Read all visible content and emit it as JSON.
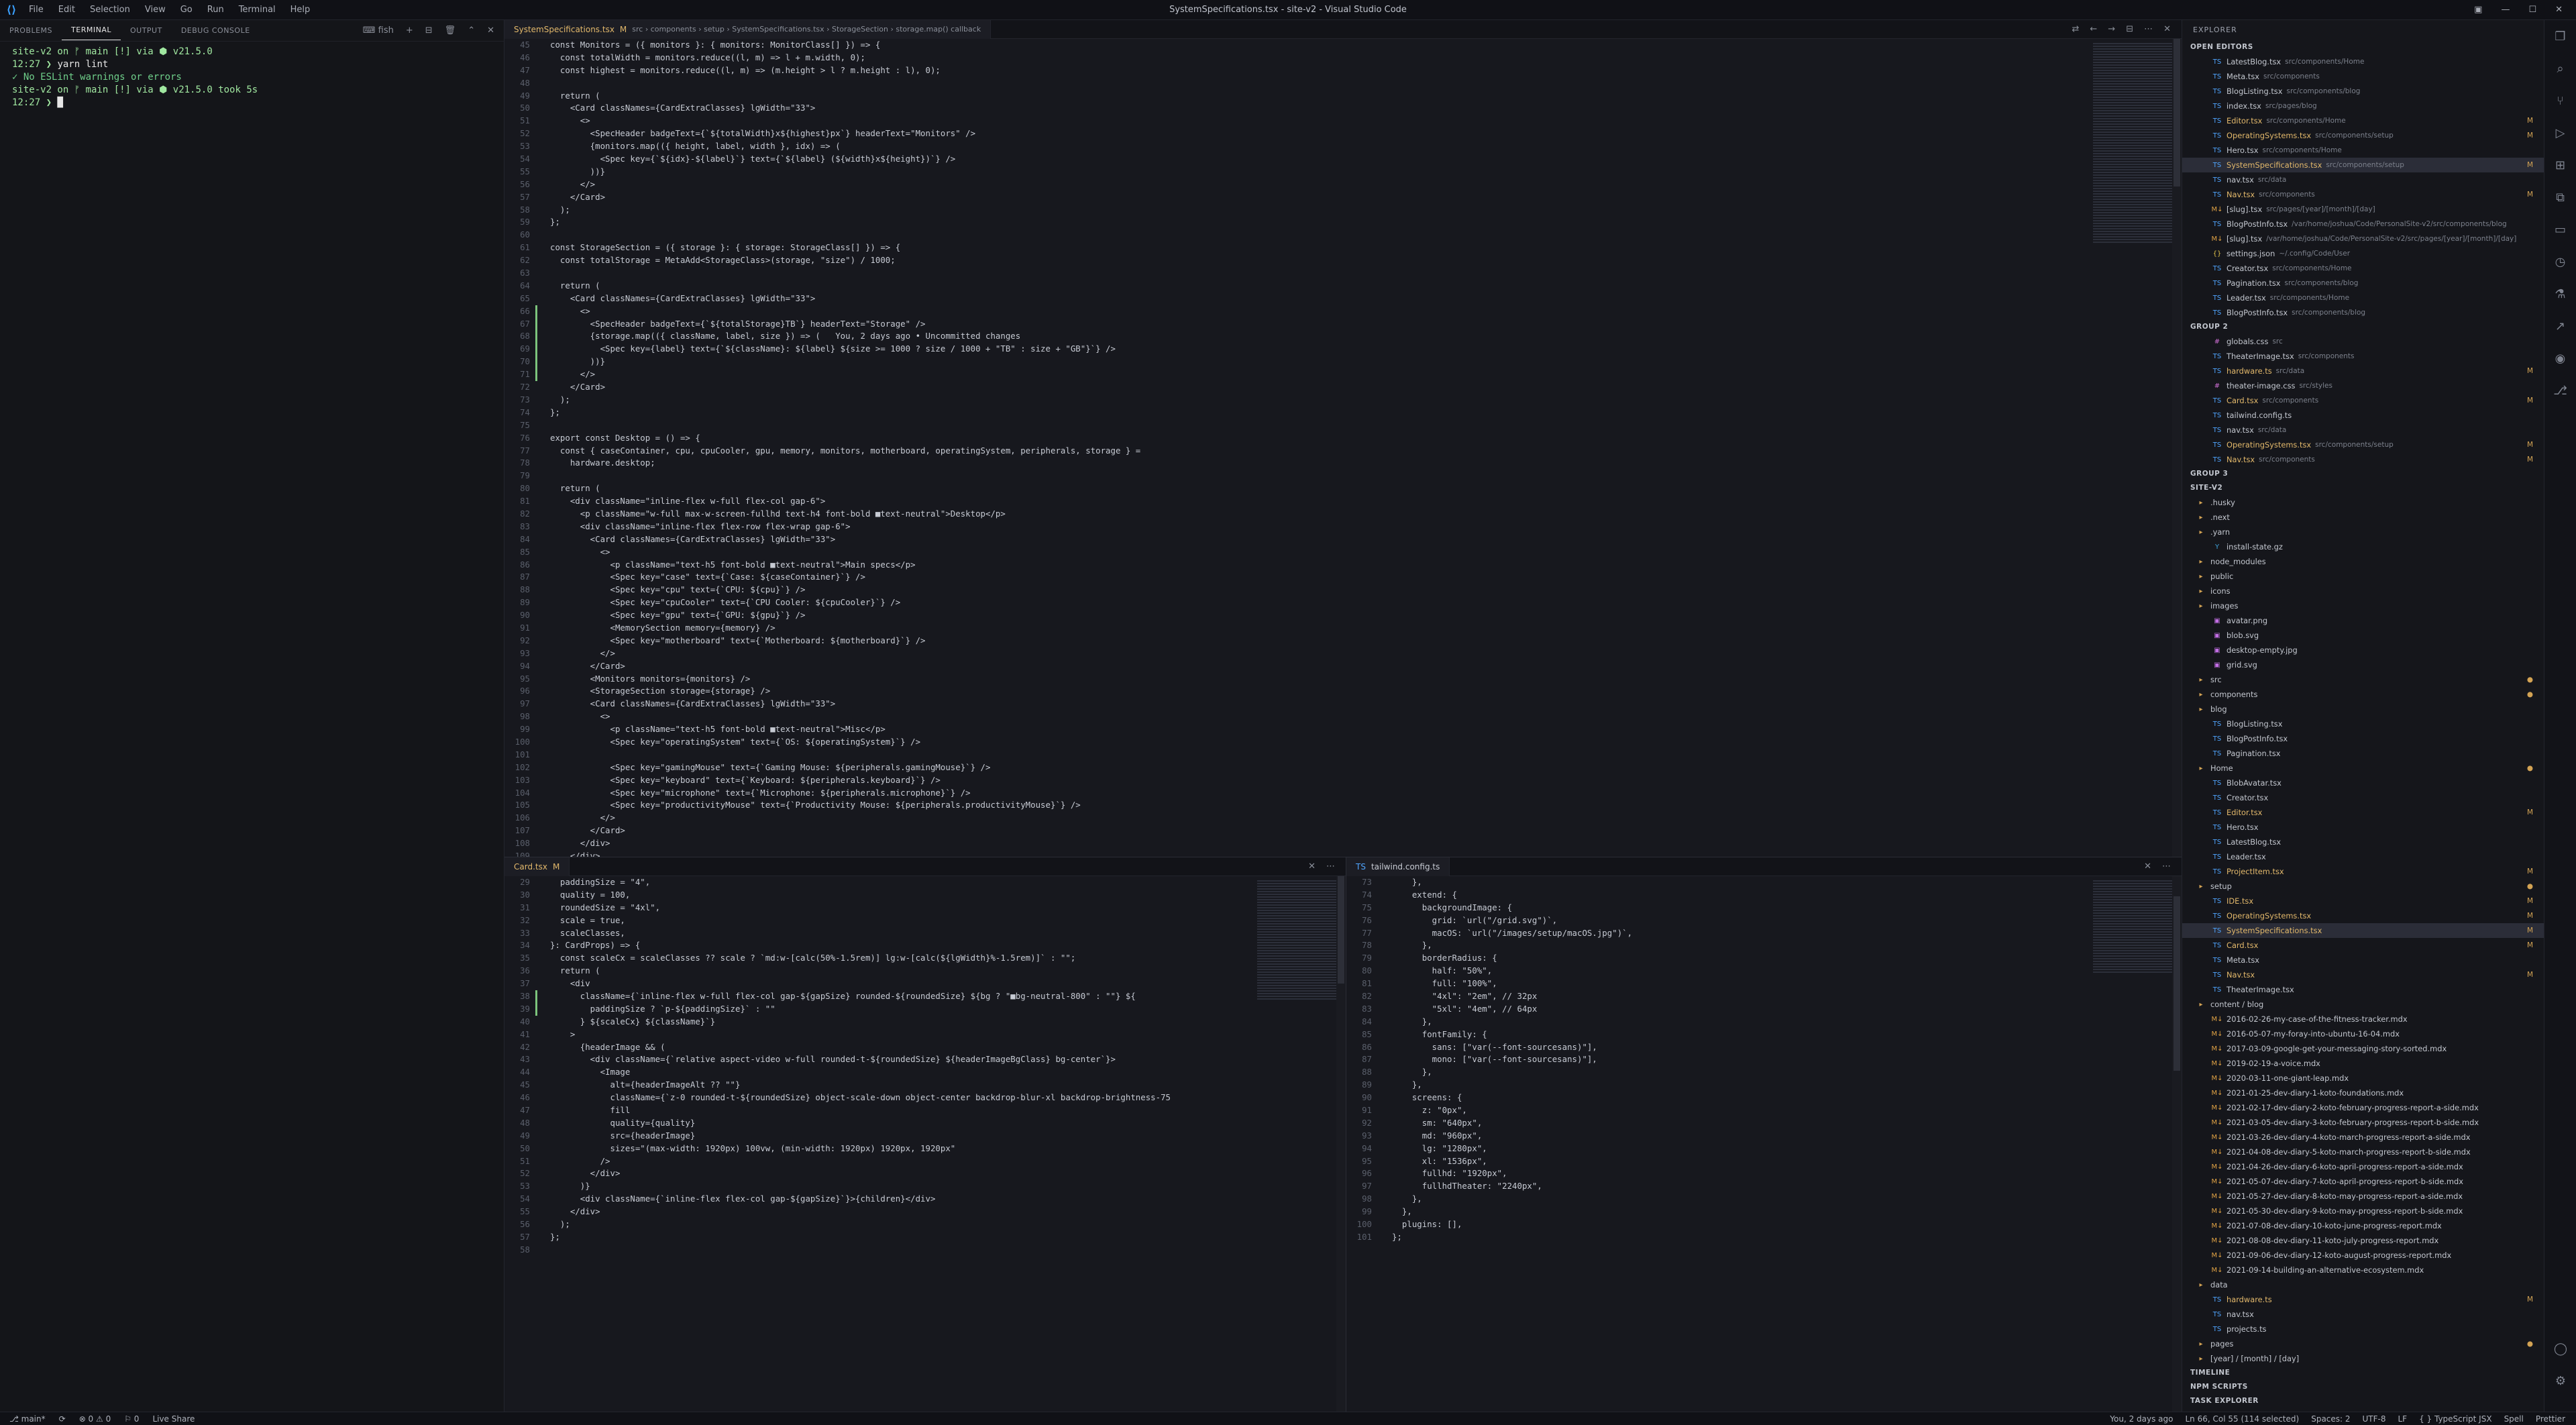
{
  "titlebar": {
    "menus": [
      "File",
      "Edit",
      "Selection",
      "View",
      "Go",
      "Run",
      "Terminal",
      "Help"
    ],
    "title": "SystemSpecifications.tsx - site-v2 - Visual Studio Code"
  },
  "panel": {
    "tabs": [
      "PROBLEMS",
      "TERMINAL",
      "OUTPUT",
      "DEBUG CONSOLE"
    ],
    "shell": "fish",
    "lines": [
      [
        "site-v2 on ᚠ main [!] via ⬢ v21.5.0",
        ""
      ],
      [
        "12:27 ❯ ",
        "yarn lint"
      ],
      [
        "✓ No ESLint warnings or errors",
        ""
      ],
      [
        "site-v2 on ᚠ main [!] via ⬢ v21.5.0 took 5s",
        ""
      ],
      [
        "12:27 ❯ ",
        ""
      ]
    ]
  },
  "editor_top": {
    "tab": "SystemSpecifications.tsx",
    "tab_mark": "M",
    "breadcrumb": "src › components › setup › SystemSpecifications.tsx › StorageSection › storage.map() callback",
    "start": 45,
    "lines": [
      "const Monitors = ({ monitors }: { monitors: MonitorClass[] }) => {",
      "  const totalWidth = monitors.reduce((l, m) => l + m.width, 0);",
      "  const highest = monitors.reduce((l, m) => (m.height > l ? m.height : l), 0);",
      "",
      "  return (",
      "    <Card classNames={CardExtraClasses} lgWidth=\"33\">",
      "      <>",
      "        <SpecHeader badgeText={`${totalWidth}x${highest}px`} headerText=\"Monitors\" />",
      "        {monitors.map(({ height, label, width }, idx) => (",
      "          <Spec key={`${idx}-${label}`} text={`${label} (${width}x${height})`} />",
      "        ))}",
      "      </>",
      "    </Card>",
      "  );",
      "};",
      "",
      "const StorageSection = ({ storage }: { storage: StorageClass[] }) => {",
      "  const totalStorage = MetaAdd<StorageClass>(storage, \"size\") / 1000;",
      "",
      "  return (",
      "    <Card classNames={CardExtraClasses} lgWidth=\"33\">",
      "      <>",
      "        <SpecHeader badgeText={`${totalStorage}TB`} headerText=\"Storage\" />",
      "        {storage.map(({ className, label, size }) => (   You, 2 days ago • Uncommitted changes",
      "          <Spec key={label} text={`${className}: ${label} ${size >= 1000 ? size / 1000 + \"TB\" : size + \"GB\"}`} />",
      "        ))}",
      "      </>",
      "    </Card>",
      "  );",
      "};",
      "",
      "export const Desktop = () => {",
      "  const { caseContainer, cpu, cpuCooler, gpu, memory, monitors, motherboard, operatingSystem, peripherals, storage } =",
      "    hardware.desktop;",
      "",
      "  return (",
      "    <div className=\"inline-flex w-full flex-col gap-6\">",
      "      <p className=\"w-full max-w-screen-fullhd text-h4 font-bold ■text-neutral\">Desktop</p>",
      "      <div className=\"inline-flex flex-row flex-wrap gap-6\">",
      "        <Card classNames={CardExtraClasses} lgWidth=\"33\">",
      "          <>",
      "            <p className=\"text-h5 font-bold ■text-neutral\">Main specs</p>",
      "            <Spec key=\"case\" text={`Case: ${caseContainer}`} />",
      "            <Spec key=\"cpu\" text={`CPU: ${cpu}`} />",
      "            <Spec key=\"cpuCooler\" text={`CPU Cooler: ${cpuCooler}`} />",
      "            <Spec key=\"gpu\" text={`GPU: ${gpu}`} />",
      "            <MemorySection memory={memory} />",
      "            <Spec key=\"motherboard\" text={`Motherboard: ${motherboard}`} />",
      "          </>",
      "        </Card>",
      "        <Monitors monitors={monitors} />",
      "        <StorageSection storage={storage} />",
      "        <Card classNames={CardExtraClasses} lgWidth=\"33\">",
      "          <>",
      "            <p className=\"text-h5 font-bold ■text-neutral\">Misc</p>",
      "            <Spec key=\"operatingSystem\" text={`OS: ${operatingSystem}`} />",
      "",
      "            <Spec key=\"gamingMouse\" text={`Gaming Mouse: ${peripherals.gamingMouse}`} />",
      "            <Spec key=\"keyboard\" text={`Keyboard: ${peripherals.keyboard}`} />",
      "            <Spec key=\"microphone\" text={`Microphone: ${peripherals.microphone}`} />",
      "            <Spec key=\"productivityMouse\" text={`Productivity Mouse: ${peripherals.productivityMouse}`} />",
      "          </>",
      "        </Card>",
      "      </div>",
      "    </div>"
    ]
  },
  "editor_left": {
    "tab": "Card.tsx",
    "tab_mark": "M",
    "start": 29,
    "lines": [
      "  paddingSize = \"4\",",
      "  quality = 100,",
      "  roundedSize = \"4xl\",",
      "  scale = true,",
      "  scaleClasses,",
      "}: CardProps) => {",
      "  const scaleCx = scaleClasses ?? scale ? `md:w-[calc(50%-1.5rem)] lg:w-[calc(${lgWidth}%-1.5rem)]` : \"\";",
      "  return (",
      "    <div",
      "      className={`inline-flex w-full flex-col gap-${gapSize} rounded-${roundedSize} ${bg ? \"■bg-neutral-800\" : \"\"} ${",
      "        paddingSize ? `p-${paddingSize}` : \"\"",
      "      } ${scaleCx} ${className}`}",
      "    >",
      "      {headerImage && (",
      "        <div className={`relative aspect-video w-full rounded-t-${roundedSize} ${headerImageBgClass} bg-center`}>",
      "          <Image",
      "            alt={headerImageAlt ?? \"\"}",
      "            className={`z-0 rounded-t-${roundedSize} object-scale-down object-center backdrop-blur-xl backdrop-brightness-75",
      "            fill",
      "            quality={quality}",
      "            src={headerImage}",
      "            sizes=\"(max-width: 1920px) 100vw, (min-width: 1920px) 1920px, 1920px\"",
      "          />",
      "        </div>",
      "      )}",
      "      <div className={`inline-flex flex-col gap-${gapSize}`}>{children}</div>",
      "    </div>",
      "  );",
      "};",
      ""
    ]
  },
  "editor_right": {
    "tab": "tailwind.config.ts",
    "start": 73,
    "lines": [
      "    },",
      "    extend: {",
      "      backgroundImage: {",
      "        grid: `url(\"/grid.svg\")`,",
      "        macOS: `url(\"/images/setup/macOS.jpg\")`,",
      "      },",
      "      borderRadius: {",
      "        half: \"50%\",",
      "        full: \"100%\",",
      "        \"4xl\": \"2em\", // 32px",
      "        \"5xl\": \"4em\", // 64px",
      "      },",
      "      fontFamily: {",
      "        sans: [\"var(--font-sourcesans)\"],",
      "        mono: [\"var(--font-sourcesans)\"],",
      "      },",
      "    },",
      "    screens: {",
      "      z: \"0px\",",
      "      sm: \"640px\",",
      "      md: \"960px\",",
      "      lg: \"1280px\",",
      "      xl: \"1536px\",",
      "      fullhd: \"1920px\",",
      "      fullhdTheater: \"2240px\",",
      "    },",
      "  },",
      "  plugins: [],",
      "};"
    ]
  },
  "explorer": {
    "title": "EXPLORER",
    "open_editors": "OPEN EDITORS",
    "rows": [
      [
        "file",
        "ts",
        "LatestBlog.tsx",
        "src/components/Home",
        ""
      ],
      [
        "file",
        "ts",
        "Meta.tsx",
        "src/components",
        ""
      ],
      [
        "file",
        "ts",
        "BlogListing.tsx",
        "src/components/blog",
        ""
      ],
      [
        "file",
        "ts",
        "index.tsx",
        "src/pages/blog",
        ""
      ],
      [
        "file",
        "ts",
        "Editor.tsx",
        "src/components/Home",
        "M"
      ],
      [
        "file",
        "ts",
        "OperatingSystems.tsx",
        "src/components/setup",
        "M"
      ],
      [
        "file",
        "ts",
        "Hero.tsx",
        "src/components/Home",
        ""
      ],
      [
        "sel",
        "ts",
        "SystemSpecifications.tsx",
        "src/components/setup",
        "M"
      ],
      [
        "file",
        "ts",
        "nav.tsx",
        "src/data",
        ""
      ],
      [
        "file",
        "ts",
        "Nav.tsx",
        "src/components",
        "M"
      ],
      [
        "file",
        "md",
        "[slug].tsx",
        "src/pages/[year]/[month]/[day]",
        ""
      ],
      [
        "file",
        "ts",
        "BlogPostInfo.tsx",
        "/var/home/joshua/Code/PersonalSite-v2/src/components/blog",
        ""
      ],
      [
        "file",
        "md",
        "[slug].tsx",
        "/var/home/joshua/Code/PersonalSite-v2/src/pages/[year]/[month]/[day]",
        ""
      ],
      [
        "file",
        "json",
        "settings.json",
        "~/.config/Code/User",
        ""
      ],
      [
        "file",
        "ts",
        "Creator.tsx",
        "src/components/Home",
        ""
      ],
      [
        "file",
        "ts",
        "Pagination.tsx",
        "src/components/blog",
        ""
      ],
      [
        "file",
        "ts",
        "Leader.tsx",
        "src/components/Home",
        ""
      ],
      [
        "file",
        "ts",
        "BlogPostInfo.tsx",
        "src/components/blog",
        ""
      ],
      [
        "sec",
        "",
        "GROUP 2",
        "",
        ""
      ],
      [
        "file",
        "css",
        "globals.css",
        "src",
        ""
      ],
      [
        "file",
        "ts",
        "TheaterImage.tsx",
        "src/components",
        ""
      ],
      [
        "file",
        "ts",
        "hardware.ts",
        "src/data",
        "M"
      ],
      [
        "file",
        "css",
        "theater-image.css",
        "src/styles",
        ""
      ],
      [
        "file",
        "ts",
        "Card.tsx",
        "src/components",
        "M"
      ],
      [
        "file",
        "ts",
        "tailwind.config.ts",
        "",
        ""
      ],
      [
        "file",
        "ts",
        "nav.tsx",
        "src/data",
        ""
      ],
      [
        "file",
        "ts",
        "OperatingSystems.tsx",
        "src/components/setup",
        "M"
      ],
      [
        "file",
        "ts",
        "Nav.tsx",
        "src/components",
        "M"
      ],
      [
        "sec",
        "",
        "GROUP 3",
        "",
        ""
      ],
      [
        "sec",
        "",
        "SITE-V2",
        "",
        ""
      ],
      [
        "dir",
        "fold",
        ".husky",
        "",
        ""
      ],
      [
        "dir",
        "fold",
        ".next",
        "",
        ""
      ],
      [
        "dir",
        "fold",
        ".yarn",
        "",
        ""
      ],
      [
        "file",
        "yarn",
        "install-state.gz",
        "",
        ""
      ],
      [
        "dir",
        "fold",
        "node_modules",
        "",
        ""
      ],
      [
        "dir",
        "fold",
        "public",
        "",
        ""
      ],
      [
        "dir",
        "fold",
        "icons",
        "",
        ""
      ],
      [
        "dir",
        "fold",
        "images",
        "",
        ""
      ],
      [
        "file",
        "img",
        "avatar.png",
        "",
        ""
      ],
      [
        "file",
        "img",
        "blob.svg",
        "",
        ""
      ],
      [
        "file",
        "img",
        "desktop-empty.jpg",
        "",
        ""
      ],
      [
        "file",
        "img",
        "grid.svg",
        "",
        ""
      ],
      [
        "dir",
        "fold",
        "src",
        "",
        "●"
      ],
      [
        "dir",
        "fold",
        "components",
        "",
        "●"
      ],
      [
        "dir",
        "fold",
        "blog",
        "",
        ""
      ],
      [
        "file",
        "ts",
        "BlogListing.tsx",
        "",
        ""
      ],
      [
        "file",
        "ts",
        "BlogPostInfo.tsx",
        "",
        ""
      ],
      [
        "file",
        "ts",
        "Pagination.tsx",
        "",
        ""
      ],
      [
        "dir",
        "fold",
        "Home",
        "",
        "●"
      ],
      [
        "file",
        "ts",
        "BlobAvatar.tsx",
        "",
        ""
      ],
      [
        "file",
        "ts",
        "Creator.tsx",
        "",
        ""
      ],
      [
        "file",
        "ts",
        "Editor.tsx",
        "",
        "M"
      ],
      [
        "file",
        "ts",
        "Hero.tsx",
        "",
        ""
      ],
      [
        "file",
        "ts",
        "LatestBlog.tsx",
        "",
        ""
      ],
      [
        "file",
        "ts",
        "Leader.tsx",
        "",
        ""
      ],
      [
        "file",
        "ts",
        "ProjectItem.tsx",
        "",
        "M"
      ],
      [
        "dir",
        "fold",
        "setup",
        "",
        "●"
      ],
      [
        "file",
        "ts",
        "IDE.tsx",
        "",
        "M"
      ],
      [
        "file",
        "ts",
        "OperatingSystems.tsx",
        "",
        "M"
      ],
      [
        "sel",
        "ts",
        "SystemSpecifications.tsx",
        "",
        "M"
      ],
      [
        "file",
        "ts",
        "Card.tsx",
        "",
        "M"
      ],
      [
        "file",
        "ts",
        "Meta.tsx",
        "",
        ""
      ],
      [
        "file",
        "ts",
        "Nav.tsx",
        "",
        "M"
      ],
      [
        "file",
        "ts",
        "TheaterImage.tsx",
        "",
        ""
      ],
      [
        "dir",
        "fold",
        "content / blog",
        "",
        ""
      ],
      [
        "file",
        "md",
        "2016-02-26-my-case-of-the-fitness-tracker.mdx",
        "",
        ""
      ],
      [
        "file",
        "md",
        "2016-05-07-my-foray-into-ubuntu-16-04.mdx",
        "",
        ""
      ],
      [
        "file",
        "md",
        "2017-03-09-google-get-your-messaging-story-sorted.mdx",
        "",
        ""
      ],
      [
        "file",
        "md",
        "2019-02-19-a-voice.mdx",
        "",
        ""
      ],
      [
        "file",
        "md",
        "2020-03-11-one-giant-leap.mdx",
        "",
        ""
      ],
      [
        "file",
        "md",
        "2021-01-25-dev-diary-1-koto-foundations.mdx",
        "",
        ""
      ],
      [
        "file",
        "md",
        "2021-02-17-dev-diary-2-koto-february-progress-report-a-side.mdx",
        "",
        ""
      ],
      [
        "file",
        "md",
        "2021-03-05-dev-diary-3-koto-february-progress-report-b-side.mdx",
        "",
        ""
      ],
      [
        "file",
        "md",
        "2021-03-26-dev-diary-4-koto-march-progress-report-a-side.mdx",
        "",
        ""
      ],
      [
        "file",
        "md",
        "2021-04-08-dev-diary-5-koto-march-progress-report-b-side.mdx",
        "",
        ""
      ],
      [
        "file",
        "md",
        "2021-04-26-dev-diary-6-koto-april-progress-report-a-side.mdx",
        "",
        ""
      ],
      [
        "file",
        "md",
        "2021-05-07-dev-diary-7-koto-april-progress-report-b-side.mdx",
        "",
        ""
      ],
      [
        "file",
        "md",
        "2021-05-27-dev-diary-8-koto-may-progress-report-a-side.mdx",
        "",
        ""
      ],
      [
        "file",
        "md",
        "2021-05-30-dev-diary-9-koto-may-progress-report-b-side.mdx",
        "",
        ""
      ],
      [
        "file",
        "md",
        "2021-07-08-dev-diary-10-koto-june-progress-report.mdx",
        "",
        ""
      ],
      [
        "file",
        "md",
        "2021-08-08-dev-diary-11-koto-july-progress-report.mdx",
        "",
        ""
      ],
      [
        "file",
        "md",
        "2021-09-06-dev-diary-12-koto-august-progress-report.mdx",
        "",
        ""
      ],
      [
        "file",
        "md",
        "2021-09-14-building-an-alternative-ecosystem.mdx",
        "",
        ""
      ],
      [
        "dir",
        "fold",
        "data",
        "",
        ""
      ],
      [
        "file",
        "ts",
        "hardware.ts",
        "",
        "M"
      ],
      [
        "file",
        "ts",
        "nav.tsx",
        "",
        ""
      ],
      [
        "file",
        "ts",
        "projects.ts",
        "",
        ""
      ],
      [
        "dir",
        "fold",
        "pages",
        "",
        "●"
      ],
      [
        "dir",
        "fold",
        "[year] / [month] / [day]",
        "",
        ""
      ],
      [
        "sec",
        "",
        "TIMELINE",
        "",
        ""
      ],
      [
        "sec",
        "",
        "NPM SCRIPTS",
        "",
        ""
      ],
      [
        "sec",
        "",
        "TASK EXPLORER",
        "",
        ""
      ]
    ]
  },
  "statusbar": {
    "left": [
      "⎇ main*",
      "⟳",
      "⊗ 0 ⚠ 0",
      "⚐ 0",
      "Live Share"
    ],
    "right": [
      "You, 2 days ago",
      "Ln 66, Col 55 (114 selected)",
      "Spaces: 2",
      "UTF-8",
      "LF",
      "{ } TypeScript JSX",
      "Spell",
      "Prettier"
    ]
  }
}
